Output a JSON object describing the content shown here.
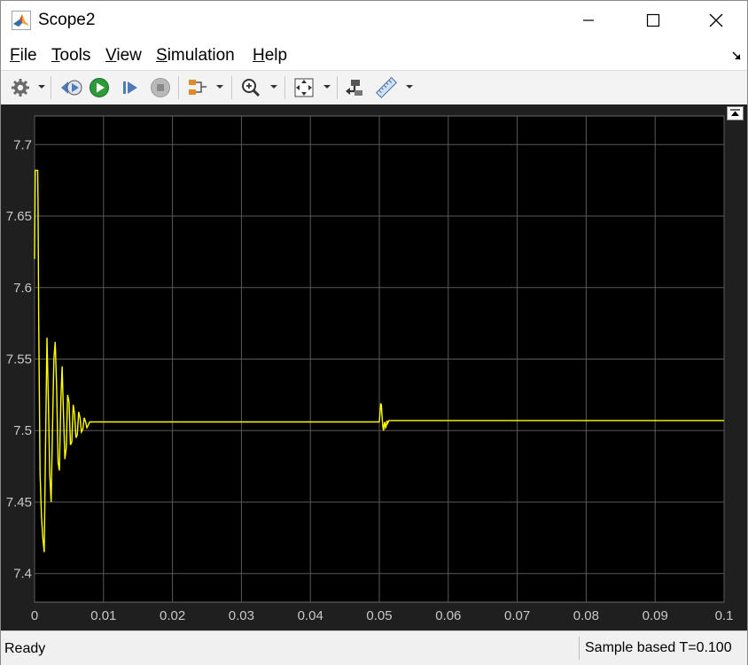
{
  "window": {
    "title": "Scope2"
  },
  "menu": {
    "items": [
      {
        "first": "F",
        "rest": "ile"
      },
      {
        "first": "T",
        "rest": "ools"
      },
      {
        "first": "V",
        "rest": "iew"
      },
      {
        "first": "S",
        "rest": "imulation"
      },
      {
        "first": "H",
        "rest": "elp"
      }
    ]
  },
  "toolbar": {
    "buttons": [
      "settings-icon",
      "step-back-icon",
      "run-icon",
      "step-forward-icon",
      "stop-icon",
      "signal-selector-icon",
      "zoom-icon",
      "fit-to-view-icon",
      "highlight-block-icon",
      "measurements-icon"
    ]
  },
  "chart_data": {
    "type": "line",
    "xlim": [
      0,
      0.1
    ],
    "ylim": [
      7.38,
      7.72
    ],
    "x_ticks": [
      "0",
      "0.01",
      "0.02",
      "0.03",
      "0.04",
      "0.05",
      "0.06",
      "0.07",
      "0.08",
      "0.09",
      "0.1"
    ],
    "y_ticks": [
      "7.4",
      "7.45",
      "7.5",
      "7.55",
      "7.6",
      "7.65",
      "7.7"
    ],
    "grid": true,
    "background": "#000000",
    "axes_color": "#1f1f1f",
    "grid_color": "#5a5a5a",
    "series": [
      {
        "color": "#ffff00",
        "x": [
          0,
          0.0001,
          0.0002,
          0.00045,
          0.0005,
          0.0006,
          0.0008,
          0.001,
          0.0012,
          0.0014,
          0.0016,
          0.0018,
          0.002,
          0.0022,
          0.0024,
          0.0026,
          0.0028,
          0.003,
          0.0032,
          0.0034,
          0.0036,
          0.0038,
          0.004,
          0.0042,
          0.0044,
          0.0046,
          0.0048,
          0.005,
          0.0052,
          0.0054,
          0.0056,
          0.0058,
          0.006,
          0.0062,
          0.0064,
          0.0066,
          0.0068,
          0.007,
          0.0072,
          0.0074,
          0.0076,
          0.0078,
          0.008,
          0.009,
          0.01,
          0.02,
          0.03,
          0.04,
          0.05,
          0.0501,
          0.0502,
          0.0503,
          0.0504,
          0.0505,
          0.0506,
          0.0507,
          0.0508,
          0.0509,
          0.051,
          0.0511,
          0.0512,
          0.0513,
          0.0514,
          0.052,
          0.06,
          0.07,
          0.08,
          0.09,
          0.1
        ],
        "y": [
          7.62,
          7.682,
          7.682,
          7.682,
          7.66,
          7.575,
          7.47,
          7.44,
          7.425,
          7.415,
          7.49,
          7.565,
          7.52,
          7.47,
          7.45,
          7.5,
          7.55,
          7.562,
          7.53,
          7.478,
          7.472,
          7.52,
          7.545,
          7.51,
          7.48,
          7.488,
          7.525,
          7.52,
          7.49,
          7.492,
          7.518,
          7.512,
          7.495,
          7.497,
          7.513,
          7.509,
          7.499,
          7.501,
          7.509,
          7.506,
          7.502,
          7.504,
          7.506,
          7.506,
          7.506,
          7.506,
          7.506,
          7.506,
          7.506,
          7.512,
          7.519,
          7.518,
          7.51,
          7.503,
          7.5,
          7.504,
          7.506,
          7.502,
          7.503,
          7.507,
          7.505,
          7.506,
          7.507,
          7.507,
          7.507,
          7.507,
          7.507,
          7.507,
          7.507
        ]
      }
    ]
  },
  "status": {
    "left": "Ready",
    "right": "Sample based  T=0.100"
  }
}
